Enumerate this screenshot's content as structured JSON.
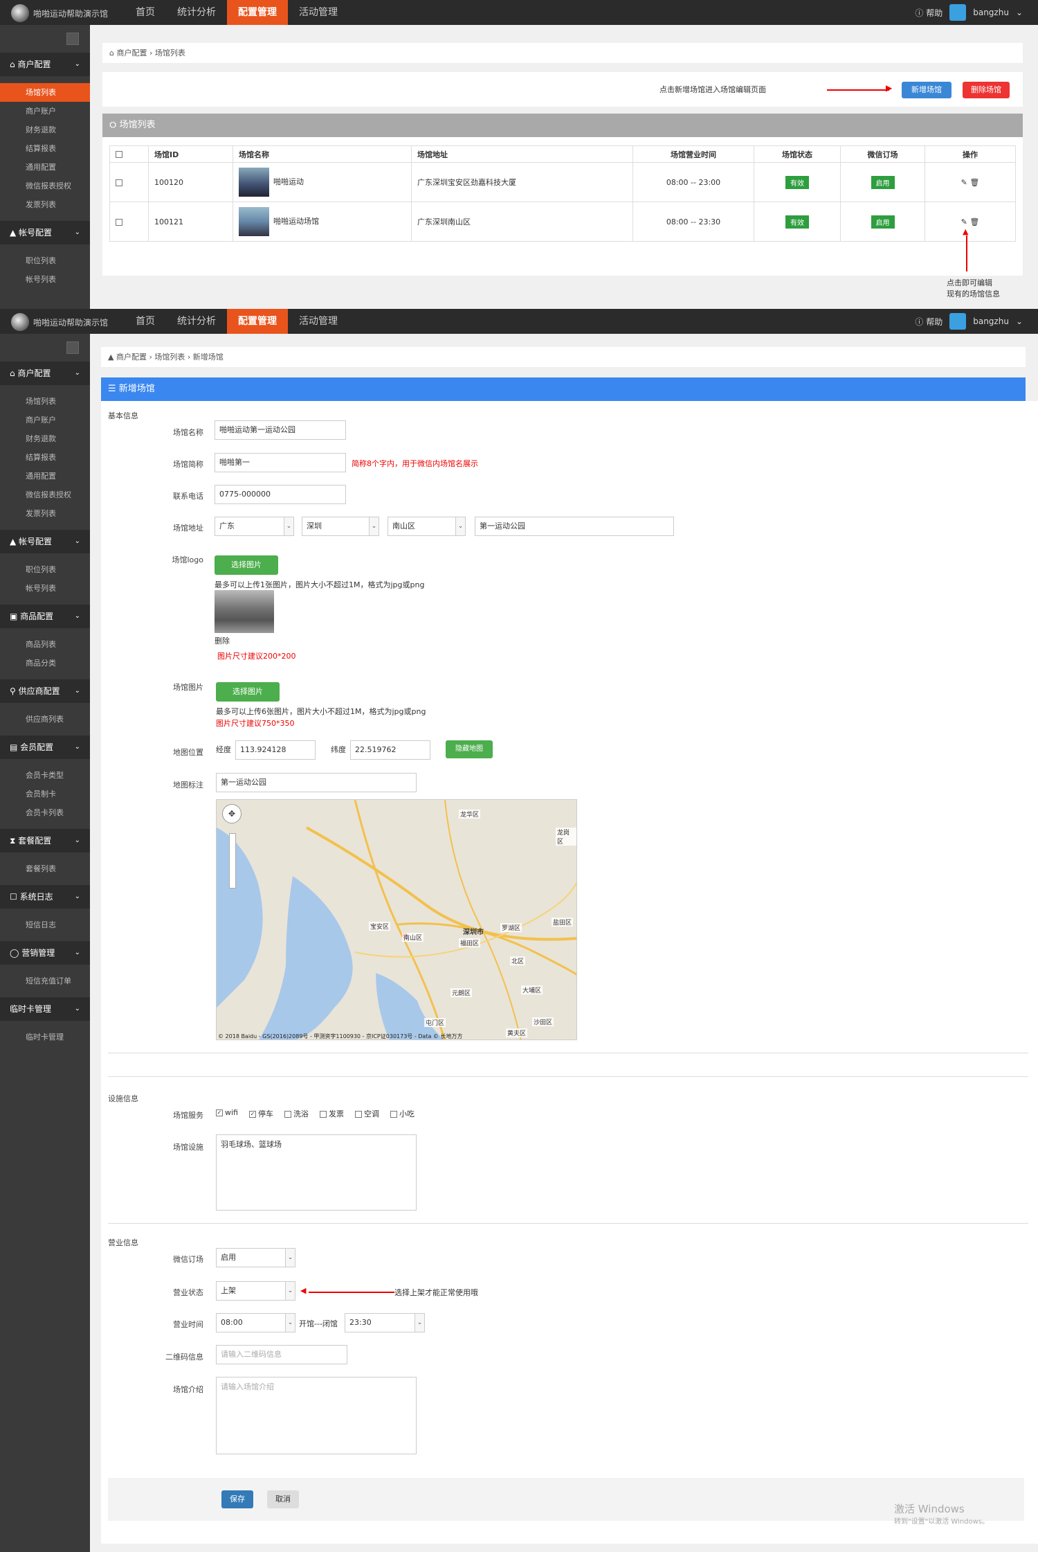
{
  "brand": "啪啪运动帮助演示馆",
  "nav": [
    "首页",
    "统计分析",
    "配置管理",
    "活动管理"
  ],
  "top_right": {
    "help": "帮助",
    "user": "bangzhu"
  },
  "sidebar1": {
    "groups": [
      {
        "label": "商户配置",
        "items": [
          "场馆列表",
          "商户账户",
          "财务退款",
          "结算报表",
          "通用配置",
          "微信报表授权",
          "发票列表"
        ]
      },
      {
        "label": "帐号配置",
        "items": [
          "职位列表",
          "帐号列表"
        ]
      }
    ]
  },
  "sidebar2": {
    "groups": [
      {
        "label": "商户配置",
        "items": [
          "场馆列表",
          "商户账户",
          "财务退款",
          "结算报表",
          "通用配置",
          "微信报表授权",
          "发票列表"
        ]
      },
      {
        "label": "帐号配置",
        "items": [
          "职位列表",
          "帐号列表"
        ]
      },
      {
        "label": "商品配置",
        "items": [
          "商品列表",
          "商品分类"
        ]
      },
      {
        "label": "供应商配置",
        "items": [
          "供应商列表"
        ]
      },
      {
        "label": "会员配置",
        "items": [
          "会员卡类型",
          "会员制卡",
          "会员卡列表"
        ]
      },
      {
        "label": "套餐配置",
        "items": [
          "套餐列表"
        ]
      },
      {
        "label": "系统日志",
        "items": [
          "短信日志"
        ]
      },
      {
        "label": "营销管理",
        "items": [
          "短信充值订单"
        ]
      },
      {
        "label": "临时卡管理",
        "items": [
          "临时卡管理"
        ]
      }
    ]
  },
  "list_page": {
    "breadcrumb": "商户配置 › 场馆列表",
    "annotation_add": "点击新增场馆进入场馆编辑页面",
    "add_button": "新增场馆",
    "delete_button": "删除场馆",
    "panel_title": "场馆列表",
    "headers": [
      "场馆ID",
      "场馆名称",
      "场馆地址",
      "场馆营业时间",
      "场馆状态",
      "微信订场",
      "操作"
    ],
    "rows": [
      {
        "id": "100120",
        "name": "啪啪运动",
        "address": "广东深圳宝安区劲嘉科技大厦",
        "hours": "08:00 -- 23:00",
        "status": "有效",
        "wechat": "启用"
      },
      {
        "id": "100121",
        "name": "啪啪运动场馆",
        "address": "广东深圳南山区",
        "hours": "08:00 -- 23:30",
        "status": "有效",
        "wechat": "启用"
      }
    ],
    "annotation_edit_1": "点击即可编辑",
    "annotation_edit_2": "现有的场馆信息"
  },
  "form_page": {
    "breadcrumb": "商户配置 › 场馆列表 › 新增场馆",
    "panel_title": "新增场馆",
    "basic_section": "基本信息",
    "fields": {
      "name_label": "场馆名称",
      "name_value": "啪啪运动第一运动公园",
      "short_label": "场馆简称",
      "short_value": "啪啪第一",
      "short_hint": "简称8个字内，用于微信内场馆名展示",
      "phone_label": "联系电话",
      "phone_value": "0775-000000",
      "addr_label": "场馆地址",
      "province": "广东",
      "city": "深圳",
      "district": "南山区",
      "street": "第一运动公园",
      "logo_label": "场馆logo",
      "choose_image": "选择图片",
      "logo_note": "最多可以上传1张图片，图片大小不超过1M，格式为jpg或png",
      "delete": "删除",
      "logo_size": "图片尺寸建议200*200",
      "pic_label": "场馆图片",
      "pic_note": "最多可以上传6张图片，图片大小不超过1M，格式为jpg或png",
      "pic_size": "图片尺寸建议750*350",
      "map_label": "地图位置",
      "lng_label": "经度",
      "lng_value": "113.924128",
      "lat_label": "纬度",
      "lat_value": "22.519762",
      "hide_map": "隐藏地图",
      "mark_label": "地图标注",
      "mark_value": "第一运动公园",
      "map_copyright": "© 2018 Baidu - GS(2016)2089号 - 甲测资字1100930 - 京ICP证030173号 - Data © 长地万方",
      "map_places": [
        "龙华区",
        "宝安区",
        "南山区",
        "福田区",
        "罗湖区",
        "深圳市",
        "盐田区",
        "龙岗区",
        "元朗区",
        "屯门区",
        "北区",
        "大埔区",
        "沙田区",
        "黄夫区"
      ]
    },
    "facility_section": "设施信息",
    "service_label": "场馆服务",
    "services": [
      {
        "label": "wifi",
        "checked": true
      },
      {
        "label": "停车",
        "checked": true
      },
      {
        "label": "洗浴",
        "checked": false
      },
      {
        "label": "发票",
        "checked": false
      },
      {
        "label": "空调",
        "checked": false
      },
      {
        "label": "小吃",
        "checked": false
      }
    ],
    "facility_label": "场馆设施",
    "facility_value": "羽毛球场、篮球场",
    "business_section": "营业信息",
    "wechat_label": "微信订场",
    "wechat_value": "启用",
    "state_label": "营业状态",
    "state_value": "上架",
    "state_annotation": "选择上架才能正常使用哦",
    "hours_label": "营业时间",
    "open_value": "08:00",
    "between": "开馆---闭馆",
    "close_value": "23:30",
    "qr_label": "二维码信息",
    "qr_placeholder": "请输入二维码信息",
    "intro_label": "场馆介绍",
    "intro_placeholder": "请输入场馆介绍",
    "save": "保存",
    "cancel": "取消",
    "watermark_1": "激活 Windows",
    "watermark_2": "转到\"设置\"以激活 Windows。"
  },
  "colors": {
    "accent": "#e8541c",
    "blue": "#3a87d6",
    "green": "#4cae4c",
    "red": "#e33"
  }
}
